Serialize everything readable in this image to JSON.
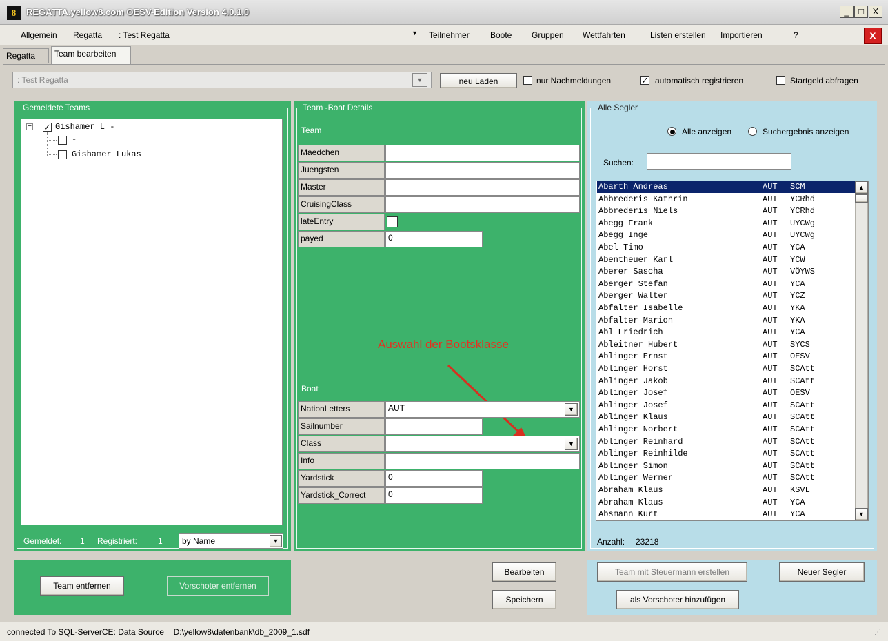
{
  "window": {
    "title": "REGATTA.yellow8.com OESV-Edition Version 4.0.1.0",
    "icon_text": "8",
    "min": "_",
    "max": "□",
    "close": "X"
  },
  "menu": {
    "allgemein": "Allgemein",
    "regatta": "Regatta",
    "regatta_value": ": Test Regatta",
    "teilnehmer": "Teilnehmer",
    "boote": "Boote",
    "gruppen": "Gruppen",
    "wettfahrten": "Wettfahrten",
    "listen": "Listen erstellen",
    "importieren": "Importieren",
    "help": "?",
    "close": "x"
  },
  "tabs": [
    "Regatta",
    "Team bearbeiten"
  ],
  "toolbar": {
    "regatta_select": ": Test Regatta",
    "reload": "neu Laden",
    "nur_nachmeldungen": "nur Nachmeldungen",
    "nur_nachmeldungen_checked": false,
    "auto_register": "automatisch registrieren",
    "auto_register_checked": true,
    "startgeld": "Startgeld abfragen",
    "startgeld_checked": false
  },
  "teams": {
    "title": "Gemeldete Teams",
    "tree": {
      "root": "Gishamer L -",
      "children": [
        "-",
        "Gishamer Lukas"
      ]
    },
    "gemeldet_label": "Gemeldet:",
    "gemeldet_value": "1",
    "registriert_label": "Registriert:",
    "registriert_value": "1",
    "sort": "by Name"
  },
  "details": {
    "title": "Team -Boat Details",
    "team_heading": "Team",
    "team_fields": [
      {
        "label": "Maedchen",
        "value": ""
      },
      {
        "label": "Juengsten",
        "value": ""
      },
      {
        "label": "Master",
        "value": ""
      },
      {
        "label": "CruisingClass",
        "value": ""
      },
      {
        "label": "lateEntry",
        "value": ""
      },
      {
        "label": "payed",
        "value": "0"
      }
    ],
    "annotation": "Auswahl der Bootsklasse",
    "boat_heading": "Boat",
    "boat_fields": [
      {
        "label": "NationLetters",
        "value": "AUT"
      },
      {
        "label": "Sailnumber",
        "value": ""
      },
      {
        "label": "Class",
        "value": ""
      },
      {
        "label": "Info",
        "value": ""
      },
      {
        "label": "Yardstick",
        "value": "0"
      },
      {
        "label": "Yardstick_Correct",
        "value": "0"
      }
    ]
  },
  "segler": {
    "title": "Alle Segler",
    "alle_anzeigen": "Alle anzeigen",
    "suchergebnis": "Suchergebnis anzeigen",
    "search_label": "Suchen:",
    "search_value": "",
    "rows": [
      [
        "Abarth Andreas",
        "AUT",
        "SCM"
      ],
      [
        "Abbrederis Kathrin",
        "AUT",
        "YCRhd"
      ],
      [
        "Abbrederis Niels",
        "AUT",
        "YCRhd"
      ],
      [
        "Abegg Frank",
        "AUT",
        "UYCWg"
      ],
      [
        "Abegg Inge",
        "AUT",
        "UYCWg"
      ],
      [
        "Abel Timo",
        "AUT",
        "YCA"
      ],
      [
        "Abentheuer Karl",
        "AUT",
        "YCW"
      ],
      [
        "Aberer Sascha",
        "AUT",
        "VÖYWS"
      ],
      [
        "Aberger Stefan",
        "AUT",
        "YCA"
      ],
      [
        "Aberger Walter",
        "AUT",
        "YCZ"
      ],
      [
        "Abfalter Isabelle",
        "AUT",
        "YKA"
      ],
      [
        "Abfalter Marion",
        "AUT",
        "YKA"
      ],
      [
        "Abl Friedrich",
        "AUT",
        "YCA"
      ],
      [
        "Ableitner Hubert",
        "AUT",
        "SYCS"
      ],
      [
        "Ablinger Ernst",
        "AUT",
        "OESV"
      ],
      [
        "Ablinger Horst",
        "AUT",
        "SCAtt"
      ],
      [
        "Ablinger Jakob",
        "AUT",
        "SCAtt"
      ],
      [
        "Ablinger Josef",
        "AUT",
        "OESV"
      ],
      [
        "Ablinger Josef",
        "AUT",
        "SCAtt"
      ],
      [
        "Ablinger Klaus",
        "AUT",
        "SCAtt"
      ],
      [
        "Ablinger Norbert",
        "AUT",
        "SCAtt"
      ],
      [
        "Ablinger Reinhard",
        "AUT",
        "SCAtt"
      ],
      [
        "Ablinger Reinhilde",
        "AUT",
        "SCAtt"
      ],
      [
        "Ablinger Simon",
        "AUT",
        "SCAtt"
      ],
      [
        "Ablinger Werner",
        "AUT",
        "SCAtt"
      ],
      [
        "Abraham Klaus",
        "AUT",
        "KSVL"
      ],
      [
        "Abraham Klaus",
        "AUT",
        "YCA"
      ],
      [
        "Absmann Kurt",
        "AUT",
        "YCA"
      ]
    ],
    "anzahl_label": "Anzahl:",
    "anzahl_value": "23218"
  },
  "buttons": {
    "team_entfernen": "Team entfernen",
    "vorschoter_entfernen": "Vorschoter entfernen",
    "bearbeiten": "Bearbeiten",
    "speichern": "Speichern",
    "team_mit_steuermann": "Team mit Steuermann erstellen",
    "neuer_segler": "Neuer Segler",
    "als_vorschoter": "als Vorschoter hinzufügen"
  },
  "status": "connected To SQL-ServerCE: Data Source = D:\\yellow8\\datenbank\\db_2009_1.sdf",
  "colors": {
    "green_panel": "#3db26b",
    "blue_panel": "#b8dde8",
    "selection": "#0b246b",
    "annotation": "#e53020"
  }
}
